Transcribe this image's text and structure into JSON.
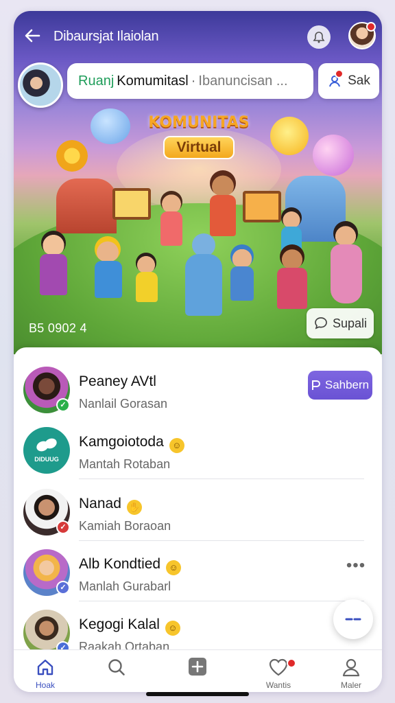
{
  "header": {
    "title": "Dibaursjat Ilaiolan",
    "back_icon": "arrow-left-icon",
    "bell_icon": "bell-icon"
  },
  "community": {
    "name_prefix": "Ruanj",
    "name": "Komumitasl",
    "separator": "·",
    "subtitle": "Ibanuncisan ...",
    "join_label": "Sak"
  },
  "banner": {
    "title": "KOMUNITAS",
    "subtitle": "Virtual",
    "date": "B5 0902 4",
    "reply_label": "Supali"
  },
  "contacts": [
    {
      "name": "Peaney AVtl",
      "status": "Nanlail Gorasan",
      "check_color": "#2bb04a",
      "avatar_bg": "#3c8f3a",
      "action_label": "Sahbern"
    },
    {
      "name": "Kamgoiotoda",
      "status": "Mantah Rotaban",
      "check_color": "",
      "avatar_bg": "#1e9b8c",
      "avatar_text": "DIDUUG",
      "emoji": "😘"
    },
    {
      "name": "Nanad",
      "status": "Kamiah Boraoan",
      "check_color": "#d63a3a",
      "avatar_bg": "#3a2b2b",
      "emoji": "✋"
    },
    {
      "name": "Alb Kondtied",
      "status": "Manlah Gurabarl",
      "check_color": "#5a6fd8",
      "avatar_bg": "#5b82c9",
      "emoji": "😆"
    },
    {
      "name": "Kegogi Kalal",
      "status": "Raakah Ortaban",
      "check_color": "#4a6fd8",
      "avatar_bg": "#7fa24a",
      "emoji": "😆"
    }
  ],
  "nav": [
    {
      "label": "Hoak",
      "icon": "home-icon",
      "active": true
    },
    {
      "label": "",
      "icon": "search-icon",
      "active": false
    },
    {
      "label": "",
      "icon": "add-icon",
      "active": false
    },
    {
      "label": "Wantis",
      "icon": "heart-icon",
      "active": false
    },
    {
      "label": "Maler",
      "icon": "profile-icon",
      "active": false
    }
  ],
  "colors": {
    "accent": "#6a52d4",
    "nav_active": "#3a4fbf",
    "badge": "#e02a2a"
  }
}
